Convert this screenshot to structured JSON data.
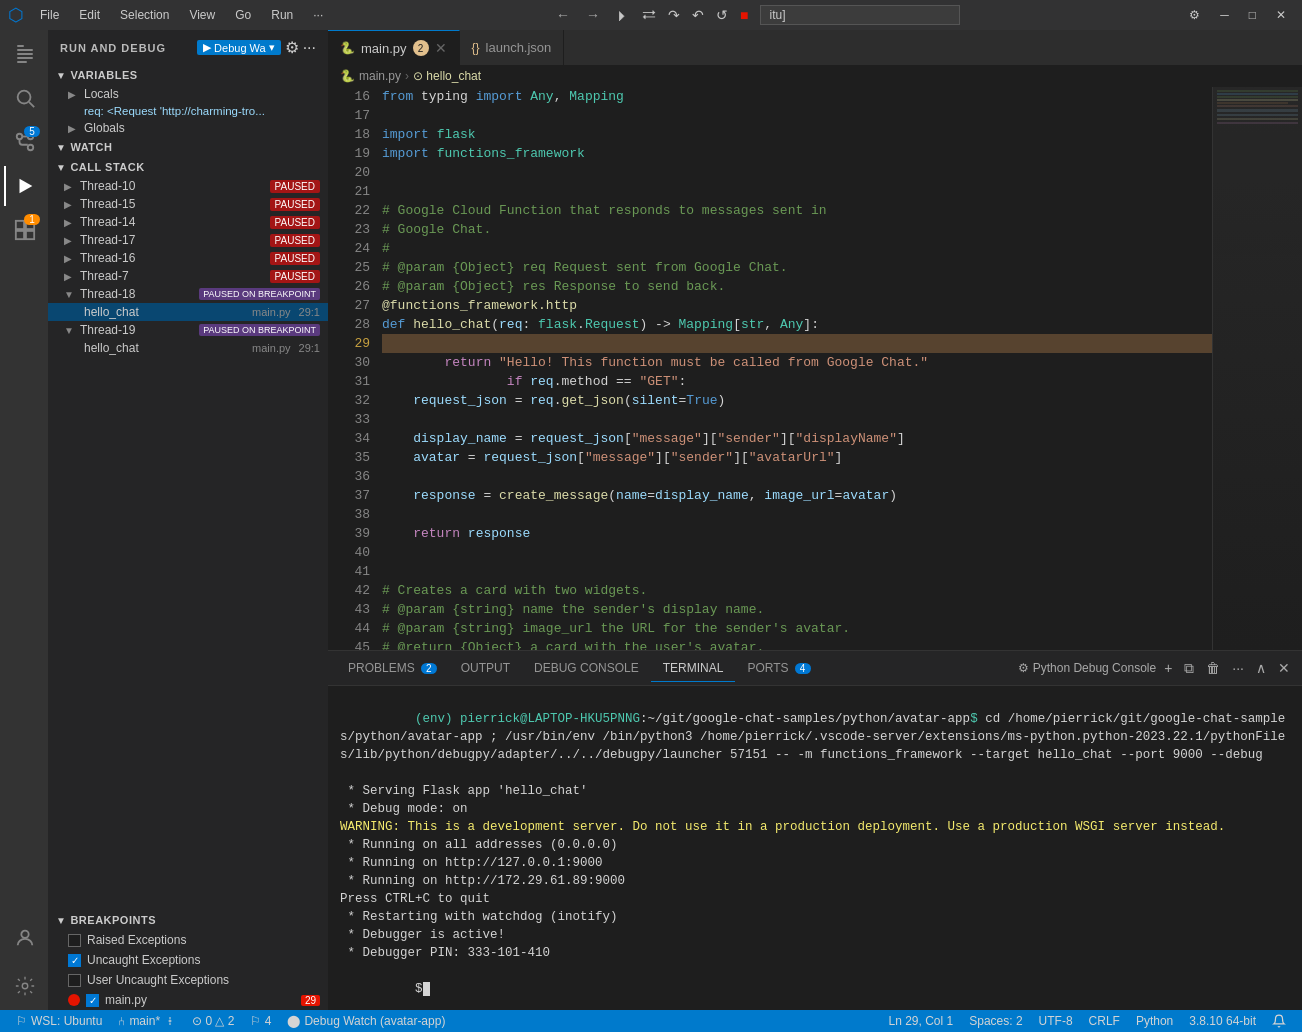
{
  "titlebar": {
    "menus": [
      "File",
      "Edit",
      "Selection",
      "View",
      "Go",
      "Run"
    ],
    "more": "...",
    "address": "itu]",
    "win_buttons": [
      "─",
      "□",
      "✕"
    ]
  },
  "debug_controls": {
    "continue": "▶",
    "step_over": "⤼",
    "step_into": "⬇",
    "step_out": "⬆",
    "restart": "↺",
    "stop": "⬛"
  },
  "activity_bar": {
    "items": [
      {
        "name": "explorer",
        "icon": "📄",
        "active": false
      },
      {
        "name": "search",
        "icon": "🔍",
        "active": false
      },
      {
        "name": "source-control",
        "icon": "⑃",
        "badge": "5",
        "active": false
      },
      {
        "name": "run-debug",
        "icon": "▶",
        "active": true
      },
      {
        "name": "extensions",
        "icon": "⊞",
        "badge_orange": "1",
        "active": false
      },
      {
        "name": "testing",
        "icon": "⊙",
        "active": false
      }
    ],
    "bottom": [
      {
        "name": "account",
        "icon": "👤"
      },
      {
        "name": "settings",
        "icon": "⚙"
      }
    ]
  },
  "sidebar": {
    "title": "Run and Debug",
    "debug_wa_label": "Debug Wa",
    "sections": {
      "variables": {
        "title": "VARIABLES",
        "locals": {
          "label": "Locals",
          "req_item": "req: <Request 'http://charming-tro..."
        },
        "globals": {
          "label": "Globals"
        }
      },
      "watch": {
        "title": "WATCH"
      },
      "call_stack": {
        "title": "CALL STACK",
        "threads": [
          {
            "name": "Thread-10",
            "status": "PAUSED"
          },
          {
            "name": "Thread-15",
            "status": "PAUSED"
          },
          {
            "name": "Thread-14",
            "status": "PAUSED"
          },
          {
            "name": "Thread-17",
            "status": "PAUSED"
          },
          {
            "name": "Thread-16",
            "status": "PAUSED"
          },
          {
            "name": "Thread-7",
            "status": "PAUSED"
          },
          {
            "name": "Thread-18",
            "status": "PAUSED ON BREAKPOINT",
            "expanded": true,
            "frames": [
              {
                "fn": "hello_chat",
                "file": "main.py",
                "line": "29:1"
              }
            ]
          },
          {
            "name": "Thread-19",
            "status": "PAUSED ON BREAKPOINT",
            "expanded": true,
            "frames": [
              {
                "fn": "hello_chat",
                "file": "main.py",
                "line": "29:1"
              }
            ]
          }
        ]
      },
      "breakpoints": {
        "title": "BREAKPOINTS",
        "items": [
          {
            "label": "Raised Exceptions",
            "checked": false
          },
          {
            "label": "Uncaught Exceptions",
            "checked": true
          },
          {
            "label": "User Uncaught Exceptions",
            "checked": false
          },
          {
            "label": "main.py",
            "checked": true,
            "dot": true,
            "count": "29"
          }
        ]
      }
    }
  },
  "editor": {
    "tabs": [
      {
        "label": "main.py",
        "badge": "2",
        "active": true,
        "icon": "🐍"
      },
      {
        "label": "launch.json",
        "active": false,
        "icon": "{}"
      }
    ],
    "breadcrumb": [
      "main.py",
      "hello_chat"
    ],
    "lines": [
      {
        "num": 16,
        "code": "from typing import Any, Mapping",
        "tokens": [
          {
            "text": "from",
            "cls": "kw"
          },
          {
            "text": " typing "
          },
          {
            "text": "import",
            "cls": "kw"
          },
          {
            "text": " Any, Mapping"
          }
        ]
      },
      {
        "num": 17,
        "code": ""
      },
      {
        "num": 18,
        "code": "import flask",
        "tokens": [
          {
            "text": "import",
            "cls": "kw"
          },
          {
            "text": " "
          },
          {
            "text": "flask",
            "cls": "cls"
          }
        ]
      },
      {
        "num": 19,
        "code": "import functions_framework",
        "tokens": [
          {
            "text": "import",
            "cls": "kw"
          },
          {
            "text": " "
          },
          {
            "text": "functions_framework",
            "cls": "cls"
          }
        ]
      },
      {
        "num": 20,
        "code": ""
      },
      {
        "num": 21,
        "code": ""
      },
      {
        "num": 22,
        "code": "# Google Cloud Function that responds to messages sent in",
        "tokens": [
          {
            "text": "# Google Cloud Function that responds to messages sent in",
            "cls": "comment"
          }
        ]
      },
      {
        "num": 23,
        "code": "# Google Chat.",
        "tokens": [
          {
            "text": "# Google Chat.",
            "cls": "comment"
          }
        ]
      },
      {
        "num": 24,
        "code": "#",
        "tokens": [
          {
            "text": "#",
            "cls": "comment"
          }
        ]
      },
      {
        "num": 25,
        "code": "# @param {Object} req Request sent from Google Chat.",
        "tokens": [
          {
            "text": "# @param {Object} req Request sent from Google Chat.",
            "cls": "comment"
          }
        ]
      },
      {
        "num": 26,
        "code": "# @param {Object} res Response to send back.",
        "tokens": [
          {
            "text": "# @param {Object} res Response to send back.",
            "cls": "comment"
          }
        ]
      },
      {
        "num": 27,
        "code": "@functions_framework.http",
        "tokens": [
          {
            "text": "@functions_framework.http",
            "cls": "decorator"
          }
        ]
      },
      {
        "num": 28,
        "code": "def hello_chat(req: flask.Request) -> Mapping[str, Any]:",
        "tokens": [
          {
            "text": "def",
            "cls": "kw"
          },
          {
            "text": " "
          },
          {
            "text": "hello_chat",
            "cls": "fn"
          },
          {
            "text": "("
          },
          {
            "text": "req",
            "cls": "param"
          },
          {
            "text": ": "
          },
          {
            "text": "flask",
            "cls": "cls"
          },
          {
            "text": "."
          },
          {
            "text": "Request",
            "cls": "cls"
          },
          {
            "text": ") -> "
          },
          {
            "text": "Mapping",
            "cls": "cls"
          },
          {
            "text": "["
          },
          {
            "text": "str",
            "cls": "cls"
          },
          {
            "text": ", "
          },
          {
            "text": "Any",
            "cls": "cls"
          },
          {
            "text": "]:"
          }
        ]
      },
      {
        "num": 29,
        "code": "    if req.method == \"GET\":",
        "breakpoint": true,
        "current": true,
        "tokens": [
          {
            "text": "    "
          },
          {
            "text": "if",
            "cls": "kw2"
          },
          {
            "text": " "
          },
          {
            "text": "req",
            "cls": "param"
          },
          {
            "text": ".method == "
          },
          {
            "text": "\"GET\"",
            "cls": "str"
          },
          {
            "text": ":"
          }
        ]
      },
      {
        "num": 30,
        "code": "        return \"Hello! This function must be called from Google Chat.\"",
        "tokens": [
          {
            "text": "        "
          },
          {
            "text": "return",
            "cls": "kw2"
          },
          {
            "text": " "
          },
          {
            "text": "\"Hello! This function must be called from Google Chat.\"",
            "cls": "str"
          }
        ]
      },
      {
        "num": 31,
        "code": ""
      },
      {
        "num": 32,
        "code": "    request_json = req.get_json(silent=True)",
        "tokens": [
          {
            "text": "    "
          },
          {
            "text": "request_json",
            "cls": "param"
          },
          {
            "text": " = "
          },
          {
            "text": "req",
            "cls": "param"
          },
          {
            "text": "."
          },
          {
            "text": "get_json",
            "cls": "fn"
          },
          {
            "text": "("
          },
          {
            "text": "silent",
            "cls": "param"
          },
          {
            "text": "="
          },
          {
            "text": "True",
            "cls": "kw"
          },
          {
            "text": ")"
          }
        ]
      },
      {
        "num": 33,
        "code": ""
      },
      {
        "num": 34,
        "code": "    display_name = request_json[\"message\"][\"sender\"][\"displayName\"]",
        "tokens": [
          {
            "text": "    "
          },
          {
            "text": "display_name",
            "cls": "param"
          },
          {
            "text": " = "
          },
          {
            "text": "request_json",
            "cls": "param"
          },
          {
            "text": "["
          },
          {
            "text": "\"message\"",
            "cls": "str"
          },
          {
            "text": "]["
          },
          {
            "text": "\"sender\"",
            "cls": "str"
          },
          {
            "text": "]["
          },
          {
            "text": "\"displayName\"",
            "cls": "str"
          },
          {
            "text": "]"
          }
        ]
      },
      {
        "num": 35,
        "code": "    avatar = request_json[\"message\"][\"sender\"][\"avatarUrl\"]",
        "tokens": [
          {
            "text": "    "
          },
          {
            "text": "avatar",
            "cls": "param"
          },
          {
            "text": " = "
          },
          {
            "text": "request_json",
            "cls": "param"
          },
          {
            "text": "["
          },
          {
            "text": "\"message\"",
            "cls": "str"
          },
          {
            "text": "]["
          },
          {
            "text": "\"sender\"",
            "cls": "str"
          },
          {
            "text": "]["
          },
          {
            "text": "\"avatarUrl\"",
            "cls": "str"
          },
          {
            "text": "]"
          }
        ]
      },
      {
        "num": 36,
        "code": ""
      },
      {
        "num": 37,
        "code": "    response = create_message(name=display_name, image_url=avatar)",
        "tokens": [
          {
            "text": "    "
          },
          {
            "text": "response",
            "cls": "param"
          },
          {
            "text": " = "
          },
          {
            "text": "create_message",
            "cls": "fn"
          },
          {
            "text": "("
          },
          {
            "text": "name",
            "cls": "param"
          },
          {
            "text": "="
          },
          {
            "text": "display_name",
            "cls": "param"
          },
          {
            "text": ", "
          },
          {
            "text": "image_url",
            "cls": "param"
          },
          {
            "text": "="
          },
          {
            "text": "avatar",
            "cls": "param"
          },
          {
            "text": ")"
          }
        ]
      },
      {
        "num": 38,
        "code": ""
      },
      {
        "num": 39,
        "code": "    return response",
        "tokens": [
          {
            "text": "    "
          },
          {
            "text": "return",
            "cls": "kw2"
          },
          {
            "text": " "
          },
          {
            "text": "response",
            "cls": "param"
          }
        ]
      },
      {
        "num": 40,
        "code": ""
      },
      {
        "num": 41,
        "code": ""
      },
      {
        "num": 42,
        "code": "# Creates a card with two widgets.",
        "tokens": [
          {
            "text": "# Creates a card with two widgets.",
            "cls": "comment"
          }
        ]
      },
      {
        "num": 43,
        "code": "# @param {string} name the sender's display name.",
        "tokens": [
          {
            "text": "# @param {string} name the sender's display name.",
            "cls": "comment"
          }
        ]
      },
      {
        "num": 44,
        "code": "# @param {string} image_url the URL for the sender's avatar.",
        "tokens": [
          {
            "text": "# @param {string} image_url the URL for the sender's avatar.",
            "cls": "comment"
          }
        ]
      },
      {
        "num": 45,
        "code": "# @return {Object} a card with the user's avatar.",
        "tokens": [
          {
            "text": "# @return {Object} a card with the user's avatar.",
            "cls": "comment"
          }
        ]
      }
    ]
  },
  "panel": {
    "tabs": [
      {
        "label": "PROBLEMS",
        "badge": "2"
      },
      {
        "label": "OUTPUT"
      },
      {
        "label": "DEBUG CONSOLE"
      },
      {
        "label": "TERMINAL",
        "active": true
      },
      {
        "label": "PORTS",
        "badge": "4"
      }
    ],
    "panel_title": "Python Debug Console",
    "terminal_lines": [
      {
        "text": "(env) pierrick@LAPTOP-HKU5PNNG:~/git/google-chat-samples/python/avatar-app$ cd /home/pierrick/git/google-chat-samples/python/avatar-app ; /usr/bin/env /bin/python3 /home/pierrick/.vscode-server/extensions/ms-python.python-2023.22.1/pythonFiles/lib/python/debugpy/adapter/../../debugpy/launcher 57151 -- -m functions_framework --target hello_chat --port 9000 --debug",
        "type": "info"
      },
      {
        "text": " * Serving Flask app 'hello_chat'",
        "type": "info"
      },
      {
        "text": " * Debug mode: on",
        "type": "info"
      },
      {
        "text": "WARNING: This is a development server. Do not use it in a production deployment. Use a production WSGI server instead.",
        "type": "warning"
      },
      {
        "text": " * Running on all addresses (0.0.0.0)",
        "type": "info"
      },
      {
        "text": " * Running on http://127.0.0.1:9000",
        "type": "info"
      },
      {
        "text": " * Running on http://172.29.61.89:9000",
        "type": "info"
      },
      {
        "text": "Press CTRL+C to quit",
        "type": "info"
      },
      {
        "text": " * Restarting with watchdog (inotify)",
        "type": "info"
      },
      {
        "text": " * Debugger is active!",
        "type": "info"
      },
      {
        "text": " * Debugger PIN: 333-101-410",
        "type": "info"
      }
    ]
  },
  "statusbar": {
    "left": [
      {
        "label": "⚐ WSL: Ubuntu",
        "icon": true
      },
      {
        "label": "⑃ main*",
        "icon": true
      },
      {
        "label": "⊙ 0 △ 2",
        "icon": true
      },
      {
        "label": "⚐ 4",
        "icon": true
      },
      {
        "label": "⬤ Debug Watch (avatar-app)",
        "icon": true
      }
    ],
    "right": [
      {
        "label": "Ln 29, Col 1"
      },
      {
        "label": "Spaces: 2"
      },
      {
        "label": "UTF-8"
      },
      {
        "label": "CRLF"
      },
      {
        "label": "Python"
      },
      {
        "label": "3.8.10 64-bit"
      }
    ]
  }
}
